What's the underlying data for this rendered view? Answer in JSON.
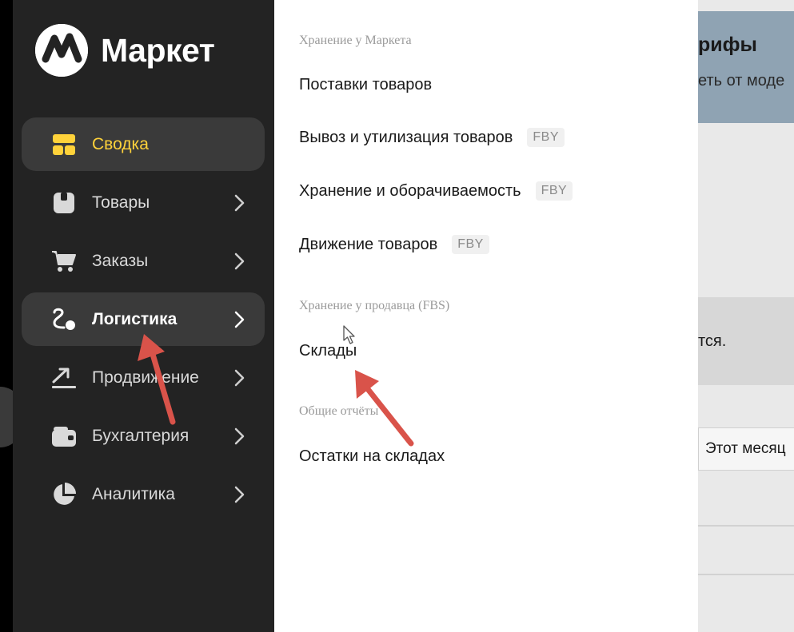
{
  "app": {
    "logo_text": "Маркет",
    "accent_color": "#ffd23a"
  },
  "sidebar": {
    "items": [
      {
        "label": "Сводка",
        "icon": "dashboard-icon",
        "active": true
      },
      {
        "label": "Товары",
        "icon": "box-icon"
      },
      {
        "label": "Заказы",
        "icon": "cart-icon"
      },
      {
        "label": "Логистика",
        "icon": "route-icon",
        "highlighted": true
      },
      {
        "label": "Продвижение",
        "icon": "trend-icon"
      },
      {
        "label": "Бухгалтерия",
        "icon": "wallet-icon"
      },
      {
        "label": "Аналитика",
        "icon": "pie-chart-icon"
      }
    ]
  },
  "submenu": {
    "sections": [
      {
        "title": "Хранение у Маркета",
        "links": [
          {
            "label": "Поставки товаров"
          },
          {
            "label": "Вывоз и утилизация товаров",
            "badge": "FBY"
          },
          {
            "label": "Хранение и оборачиваемость",
            "badge": "FBY"
          },
          {
            "label": "Движение товаров",
            "badge": "FBY"
          }
        ]
      },
      {
        "title": "Хранение у продавца (FBS)",
        "links": [
          {
            "label": "Склады"
          }
        ]
      },
      {
        "title": "Общие отчёты",
        "links": [
          {
            "label": "Остатки на складах"
          }
        ]
      }
    ]
  },
  "background_page": {
    "banner_title": "рифы",
    "banner_subtitle": "еть от моде",
    "block_text": "тся.",
    "period_label": "Этот месяц"
  },
  "annotations": {
    "arrow_color": "#d9534a"
  }
}
